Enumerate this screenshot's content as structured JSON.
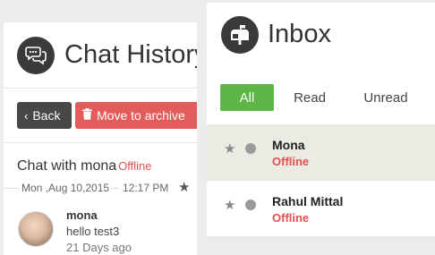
{
  "chat_history": {
    "title": "Chat History",
    "back_label": "Back",
    "archive_label": "Move to archive",
    "chat_with": "Chat with mona",
    "chat_status": "Offline",
    "date": "Mon ,Aug 10,2015",
    "time": "12:17 PM",
    "message": {
      "sender": "mona",
      "text": "hello test3",
      "ago": "21 Days ago"
    }
  },
  "inbox": {
    "title": "Inbox",
    "tabs": [
      {
        "label": "All"
      },
      {
        "label": "Read"
      },
      {
        "label": "Unread"
      }
    ],
    "conversations": [
      {
        "name": "Mona",
        "status": "Offline"
      },
      {
        "name": "Rahul Mittal",
        "status": "Offline"
      }
    ]
  },
  "colors": {
    "accent_green": "#5db646",
    "danger_red": "#e35c5c",
    "dark": "#474747",
    "status_offline": "#e55050"
  },
  "icons": [
    "chat-bubbles-icon",
    "chevron-left-icon",
    "trash-icon",
    "star-icon",
    "mailbox-icon",
    "status-dot-icon"
  ]
}
